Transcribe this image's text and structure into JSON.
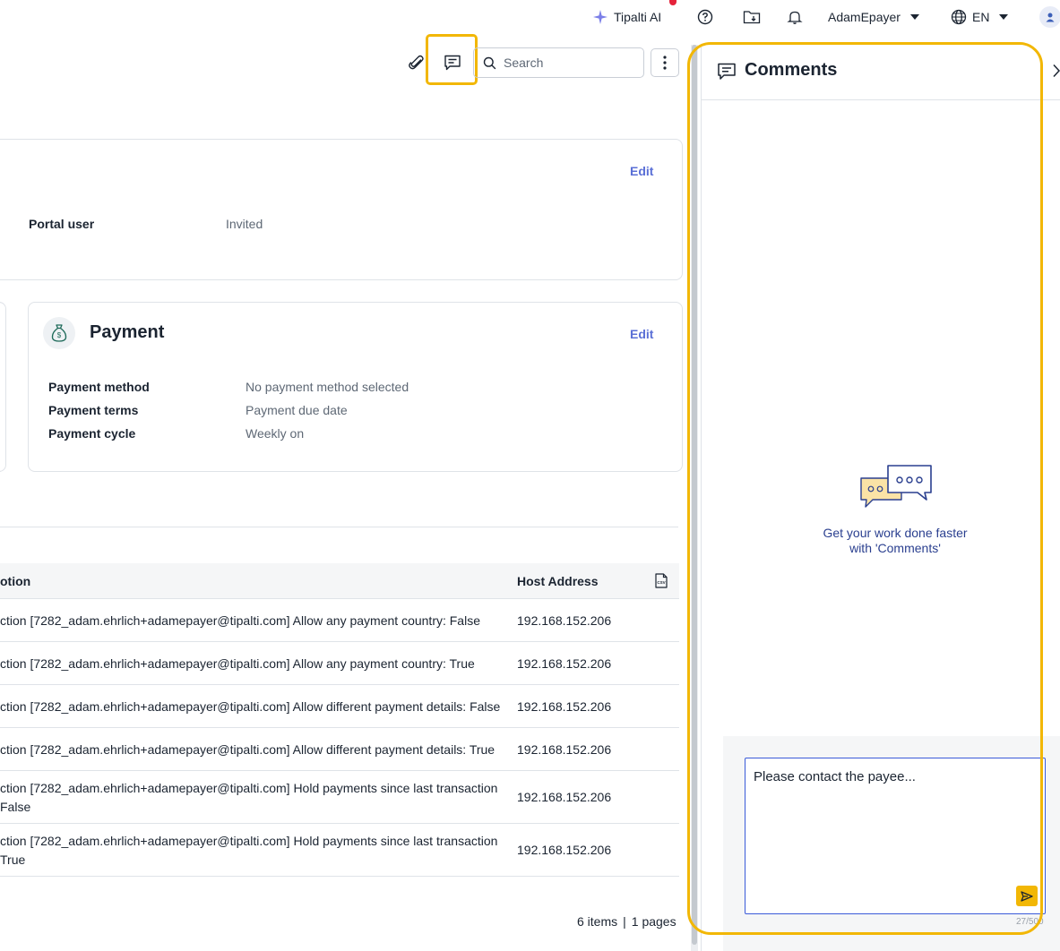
{
  "topbar": {
    "ai_label": "Tipalti AI",
    "user_name": "AdamEpayer",
    "language": "EN"
  },
  "toolbar": {
    "search_placeholder": "Search"
  },
  "user_card": {
    "edit_label": "Edit",
    "portal_user_label": "Portal user",
    "portal_user_value": "Invited"
  },
  "payment_card": {
    "title": "Payment",
    "edit_label": "Edit",
    "fields": [
      {
        "label": "Payment method",
        "value": "No payment method selected"
      },
      {
        "label": "Payment terms",
        "value": "Payment due date"
      },
      {
        "label": "Payment cycle",
        "value": "Weekly on"
      }
    ]
  },
  "table": {
    "col_description": "otion",
    "col_host": "Host Address",
    "rows": [
      {
        "line1": "ction [7282_adam.ehrlich+adamepayer@tipalti.com] Allow any payment country: False",
        "line2": "",
        "host": "192.168.152.206"
      },
      {
        "line1": "ction [7282_adam.ehrlich+adamepayer@tipalti.com] Allow any payment country: True",
        "line2": "",
        "host": "192.168.152.206"
      },
      {
        "line1": "ction [7282_adam.ehrlich+adamepayer@tipalti.com] Allow different payment details: False",
        "line2": "",
        "host": "192.168.152.206"
      },
      {
        "line1": "ction [7282_adam.ehrlich+adamepayer@tipalti.com] Allow different payment details: True",
        "line2": "",
        "host": "192.168.152.206"
      },
      {
        "line1": "ction [7282_adam.ehrlich+adamepayer@tipalti.com] Hold payments since last transaction",
        "line2": "False",
        "host": "192.168.152.206"
      },
      {
        "line1": "ction [7282_adam.ehrlich+adamepayer@tipalti.com] Hold payments since last transaction",
        "line2": "True",
        "host": "192.168.152.206"
      }
    ]
  },
  "pager": {
    "items": "6 items",
    "sep": "|",
    "pages": "1 pages"
  },
  "comments": {
    "title": "Comments",
    "empty_line1": "Get your work done faster",
    "empty_line2": "with 'Comments'",
    "draft": "Please contact the payee...",
    "char_count": "27/500"
  },
  "colors": {
    "highlight": "#f2b705",
    "link": "#5a6fd6",
    "send": "#f2b705"
  },
  "icons": [
    "sparkle-icon",
    "help-icon",
    "folder-download-icon",
    "bell-icon",
    "caret-down-icon",
    "globe-icon",
    "user-icon",
    "paperclip-icon",
    "comment-icon",
    "search-icon",
    "kebab-icon",
    "money-bag-icon",
    "csv-icon",
    "chat-bubbles-icon",
    "send-icon",
    "close-icon"
  ]
}
